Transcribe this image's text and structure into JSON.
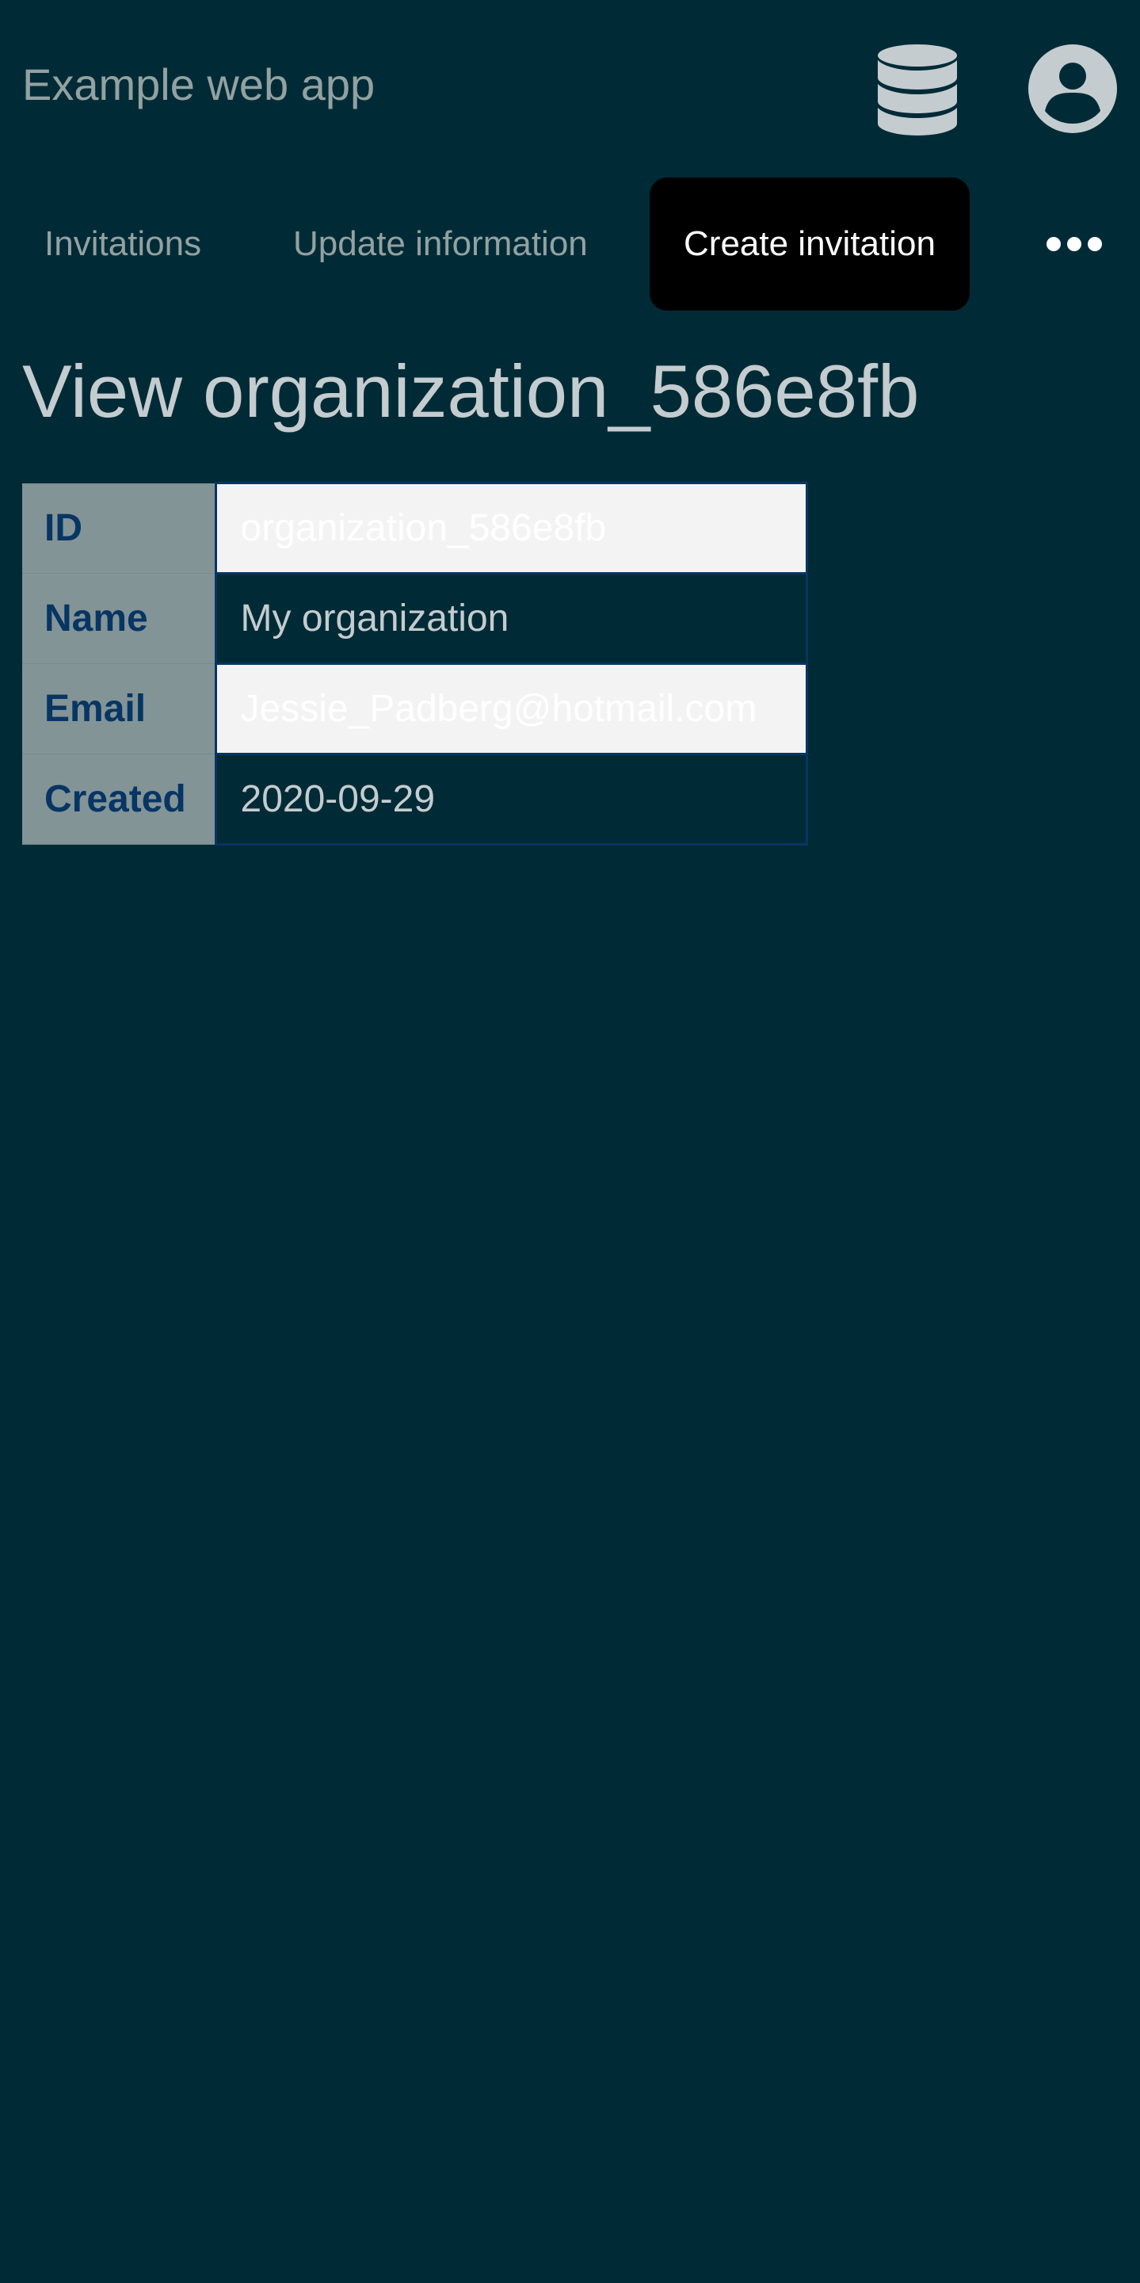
{
  "header": {
    "app_title": "Example web app",
    "icons": [
      "database-icon",
      "user-account-icon"
    ]
  },
  "nav": {
    "items": [
      {
        "label": "Invitations"
      },
      {
        "label": "Update information"
      },
      {
        "label": "Create invitation",
        "active": true
      }
    ],
    "more_icon": "more-options-icon"
  },
  "page": {
    "title": "View organization_586e8fb"
  },
  "details": {
    "rows": [
      {
        "label": "ID",
        "value": "organization_586e8fb"
      },
      {
        "label": "Name",
        "value": "My organization"
      },
      {
        "label": "Email",
        "value": "Jessie_Padberg@hotmail.com"
      },
      {
        "label": "Created",
        "value": "2020-09-29"
      }
    ]
  },
  "colors": {
    "background": "#002b36",
    "muted_text": "#93a1a1",
    "active_tab_bg": "#000000",
    "label_cell_bg": "#839496",
    "label_text": "#073564",
    "highlight_cell_bg": "#f3f3f3"
  }
}
